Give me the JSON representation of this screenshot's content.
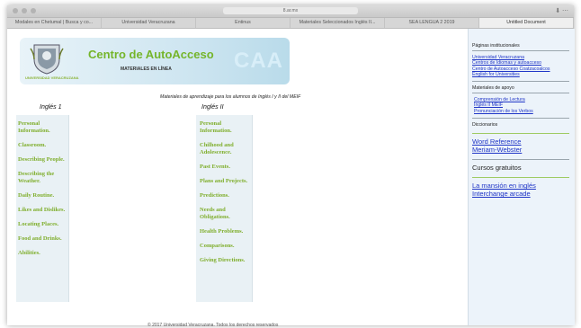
{
  "browser": {
    "url": "8.ar.mx",
    "tabs": [
      {
        "label": "Modales en Chetumal | Busca y co...",
        "active": false
      },
      {
        "label": "Universidad Veracruzana",
        "active": false
      },
      {
        "label": "Entinus",
        "active": false
      },
      {
        "label": "Materiales Seleccionados Inglés II...",
        "active": false
      },
      {
        "label": "SEA LENGUA 2 2019",
        "active": false
      },
      {
        "label": "Untitled Document",
        "active": true
      }
    ]
  },
  "banner": {
    "university": "UNIVERSIDAD VERACRUZANA",
    "title": "Centro de AutoAcceso",
    "subtitle": "MATERIALES EN LÍNEA",
    "logo": "CAA"
  },
  "intro": "Materiales de aprendizaje para los alumnos de Inglés I y II del MEIF",
  "ingles1": {
    "heading": "Inglés 1",
    "items": [
      "Personal Information.",
      "Classroom.",
      "Describing People.",
      "Describing the Weather.",
      "Daily Routine.",
      "Likes and Dislikes.",
      "Locating Places.",
      "Food and Drinks.",
      "Abilities."
    ]
  },
  "ingles2": {
    "heading": "Inglés II",
    "items": [
      "Personal Information.",
      "Chilhood and Adolescence.",
      "Past Events.",
      "Plans and Projects.",
      "Predictions.",
      "Needs and Obligations.",
      "Health Problems.",
      "Comparisons.",
      "Giving Directions."
    ]
  },
  "sidebar": {
    "institucionales": {
      "title": "Páginas institucionales",
      "links": [
        "Universidad Veracruzana",
        "Centros de Idiomas y autoacceso",
        "Centro de Autoacceso Coatzacoalcos",
        "English for Universities"
      ]
    },
    "apoyo": {
      "title": "Materiales de apoyo",
      "links": [
        "Comprensión de Lectura",
        "Inglés II MEIF",
        "Pronunciación de los Verbos"
      ]
    },
    "diccionarios": {
      "title": "Diccionarios",
      "links": [
        "Word Reference",
        "Meriam-Webster"
      ]
    },
    "cursos": {
      "title": "Cursos gratuitos",
      "links": [
        "La mansión en inglés",
        "Interchange arcade"
      ]
    }
  },
  "footer": "© 2017 Universidad Veracruzana. Todos los derechos reservados"
}
